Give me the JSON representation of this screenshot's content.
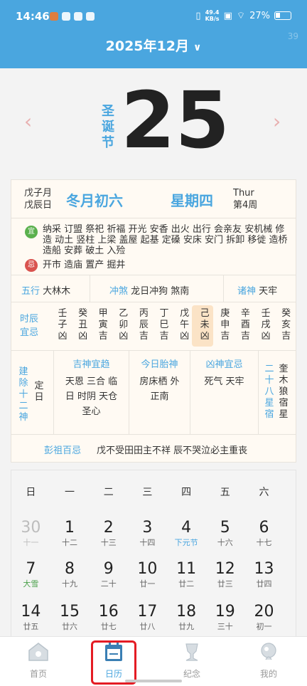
{
  "status_bar": {
    "time": "14:46",
    "net_speed_value": "49.4",
    "net_speed_unit": "KB/s",
    "battery": "27%"
  },
  "header": {
    "month": "2025年12月",
    "watermark": "39"
  },
  "hero": {
    "festival": "圣诞节",
    "day": "25"
  },
  "date_row": {
    "ganzhi_month": "戊子月",
    "ganzhi_day": "戊辰日",
    "lunar": "冬月初六",
    "weekday": "星期四",
    "eng_day": "Thur",
    "week_num": "第4周"
  },
  "yiji": {
    "yi_tag": "宜",
    "yi": "纳采 订盟 祭祀 祈福 开光 安香 出火 出行 会亲友 安机械 修造 动土 竖柱 上梁 盖屋 起基 定磉 安床 安门 拆卸 移徙 造桥 造船 安葬 破土 入殓",
    "ji_tag": "忌",
    "ji": "开市 造庙 置产 掘井"
  },
  "wuxing": {
    "wuxing_label": "五行",
    "wuxing_value": "大林木",
    "chongsha_label": "冲煞",
    "chongsha_value": "龙日冲狗 煞南",
    "zhushen_label": "诸神",
    "zhushen_value": "天牢"
  },
  "hours": {
    "title": "时辰宜忌",
    "cols": [
      [
        "壬",
        "子",
        "凶"
      ],
      [
        "癸",
        "丑",
        "凶"
      ],
      [
        "甲",
        "寅",
        "吉"
      ],
      [
        "乙",
        "卯",
        "凶"
      ],
      [
        "丙",
        "辰",
        "吉"
      ],
      [
        "丁",
        "巳",
        "吉"
      ],
      [
        "戊",
        "午",
        "凶"
      ],
      [
        "己",
        "未",
        "凶"
      ],
      [
        "庚",
        "申",
        "吉"
      ],
      [
        "辛",
        "酉",
        "吉"
      ],
      [
        "壬",
        "戌",
        "凶"
      ],
      [
        "癸",
        "亥",
        "吉"
      ]
    ]
  },
  "gods": {
    "jianchu_label": "建除十二神",
    "jianchu_value": "定日",
    "jishen_label": "吉神宜趋",
    "jishen_value": "天恩 三合 临日 时阴 天仓 圣心",
    "taishen_label": "今日胎神",
    "taishen_value": "房床栖 外正南",
    "xiongshen_label": "凶神宜忌",
    "xiongshen_value": "死气 天牢",
    "xiu_label": "二十八星宿",
    "xiu_value": "奎木狼宿星"
  },
  "pengzu": {
    "label": "彭祖百忌",
    "text": "戊不受田田主不祥 辰不哭泣必主重丧"
  },
  "calendar": {
    "weekdays": [
      "日",
      "一",
      "二",
      "三",
      "四",
      "五",
      "六"
    ],
    "weeks": [
      [
        {
          "d": "30",
          "s": "十一",
          "dim": true
        },
        {
          "d": "1",
          "s": "十二"
        },
        {
          "d": "2",
          "s": "十三"
        },
        {
          "d": "3",
          "s": "十四"
        },
        {
          "d": "4",
          "s": "下元节",
          "c": "blue"
        },
        {
          "d": "5",
          "s": "十六"
        },
        {
          "d": "6",
          "s": "十七"
        }
      ],
      [
        {
          "d": "7",
          "s": "大雪",
          "c": "green"
        },
        {
          "d": "8",
          "s": "十九"
        },
        {
          "d": "9",
          "s": "二十"
        },
        {
          "d": "10",
          "s": "廿一"
        },
        {
          "d": "11",
          "s": "廿二"
        },
        {
          "d": "12",
          "s": "廿三"
        },
        {
          "d": "13",
          "s": "廿四"
        }
      ],
      [
        {
          "d": "14",
          "s": "廿五"
        },
        {
          "d": "15",
          "s": "廿六"
        },
        {
          "d": "16",
          "s": "廿七"
        },
        {
          "d": "17",
          "s": "廿八"
        },
        {
          "d": "18",
          "s": "廿九"
        },
        {
          "d": "19",
          "s": "三十"
        },
        {
          "d": "20",
          "s": "初一"
        }
      ]
    ]
  },
  "tabs": [
    {
      "label": "首页",
      "icon": "home-icon"
    },
    {
      "label": "日历",
      "icon": "calendar-icon"
    },
    {
      "label": "纪念",
      "icon": "memorial-icon"
    },
    {
      "label": "我的",
      "icon": "profile-icon"
    }
  ],
  "colors": {
    "accent": "#4aa6df",
    "active_outline": "#e41c24",
    "yi": "#5ab04d",
    "ji": "#d9534f"
  }
}
